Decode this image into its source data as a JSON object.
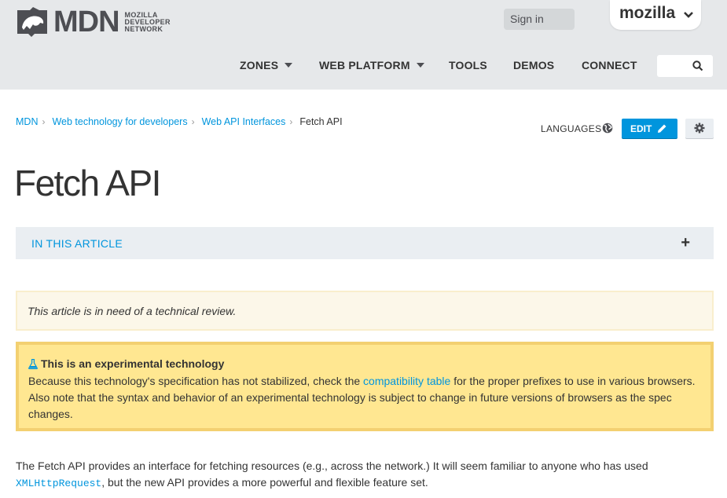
{
  "header": {
    "logo_text": "MDN",
    "logo_sub": [
      "MOZILLA",
      "DEVELOPER",
      "NETWORK"
    ],
    "signin_label": "Sign in",
    "mozilla_label": "mozilla",
    "nav": [
      {
        "label": "ZONES",
        "has_dropdown": true
      },
      {
        "label": "WEB PLATFORM",
        "has_dropdown": true
      },
      {
        "label": "TOOLS",
        "has_dropdown": false
      },
      {
        "label": "DEMOS",
        "has_dropdown": false
      },
      {
        "label": "CONNECT",
        "has_dropdown": false
      }
    ],
    "search_icon": "search-icon"
  },
  "breadcrumb": {
    "items": [
      "MDN",
      "Web technology for developers",
      "Web API Interfaces"
    ],
    "current": "Fetch API"
  },
  "page_actions": {
    "languages_label": "LANGUAGES",
    "edit_label": "EDIT"
  },
  "page": {
    "title": "Fetch API",
    "toc_label": "IN THIS ARTICLE",
    "toc_toggle": "+",
    "review_notice": "This article is in need of a technical review.",
    "experimental": {
      "heading": "This is an experimental technology",
      "body_before": "Because this technology's specification has not stabilized, check the ",
      "link": "compatibility table",
      "body_after": " for the proper prefixes to use in various browsers. Also note that the syntax and behavior of an experimental technology is subject to change in future versions of browsers as the spec changes."
    },
    "intro": {
      "text_before": "The Fetch API provides an interface for fetching resources (e.g., across the network.) It will seem familiar to anyone who has used ",
      "code": "XMLHttpRequest",
      "text_after": ", but the new API provides a more powerful and flexible feature set."
    }
  },
  "colors": {
    "link": "#0095dd",
    "header_bg": "#e6e8ea",
    "notice_bg": "#ffe791",
    "notice_border": "#f3d071"
  }
}
